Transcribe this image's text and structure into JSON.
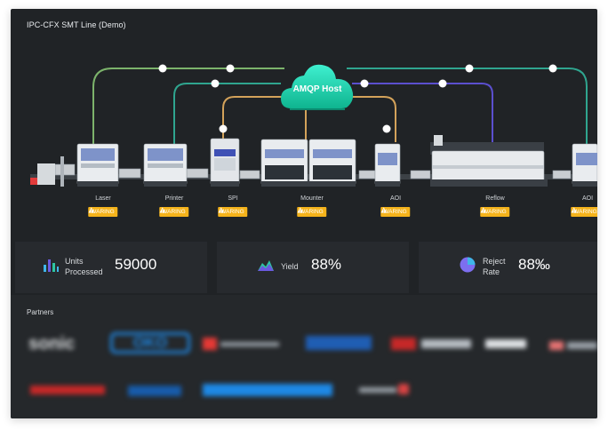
{
  "title": "IPC-CFX SMT Line (Demo)",
  "host": {
    "label": "AMQP Host",
    "colors": {
      "cloud_top": "#34e7c7",
      "cloud_bottom": "#10b893"
    }
  },
  "stations": [
    {
      "name": "Laser",
      "status": "WARING"
    },
    {
      "name": "Printer",
      "status": "WARING"
    },
    {
      "name": "SPI",
      "status": "WARING"
    },
    {
      "name": "Mounter",
      "status": "WARING"
    },
    {
      "name": "AOI",
      "status": "WARING"
    },
    {
      "name": "Reflow",
      "status": "WARING"
    },
    {
      "name": "AOI",
      "status": "WARING"
    }
  ],
  "kpis": [
    {
      "label_line1": "Units",
      "label_line2": "Processed",
      "value": "59000",
      "icon": "bar-chart-icon"
    },
    {
      "label_line1": "Yield",
      "label_line2": "",
      "value": "88%",
      "icon": "area-chart-icon"
    },
    {
      "label_line1": "Reject",
      "label_line2": "Rate",
      "value": "88‰",
      "icon": "pie-chart-icon"
    }
  ],
  "partners": {
    "title": "Partners",
    "logos": [
      {
        "name": "sonic",
        "color": "#d9dbdd"
      },
      {
        "name": "OKO",
        "color": "#1e88e5"
      },
      {
        "name": "",
        "color": "#e53935"
      },
      {
        "name": "",
        "color": "#1e6bd6"
      },
      {
        "name": "",
        "color": "#c62828"
      },
      {
        "name": "",
        "color": "#dfe2e5"
      },
      {
        "name": "",
        "color": "#e57373"
      },
      {
        "name": "",
        "color": "#c62828"
      },
      {
        "name": "",
        "color": "#1565c0"
      },
      {
        "name": "",
        "color": "#1e88e5"
      },
      {
        "name": "",
        "color": "#d84343"
      }
    ]
  },
  "colors": {
    "background": "#202326",
    "panel": "#272a2e",
    "warning": "#f5b31b",
    "line_green": "#7cb36b",
    "line_teal": "#2fa58f",
    "line_purple": "#5b4fcf",
    "line_orange": "#d3a25a"
  }
}
